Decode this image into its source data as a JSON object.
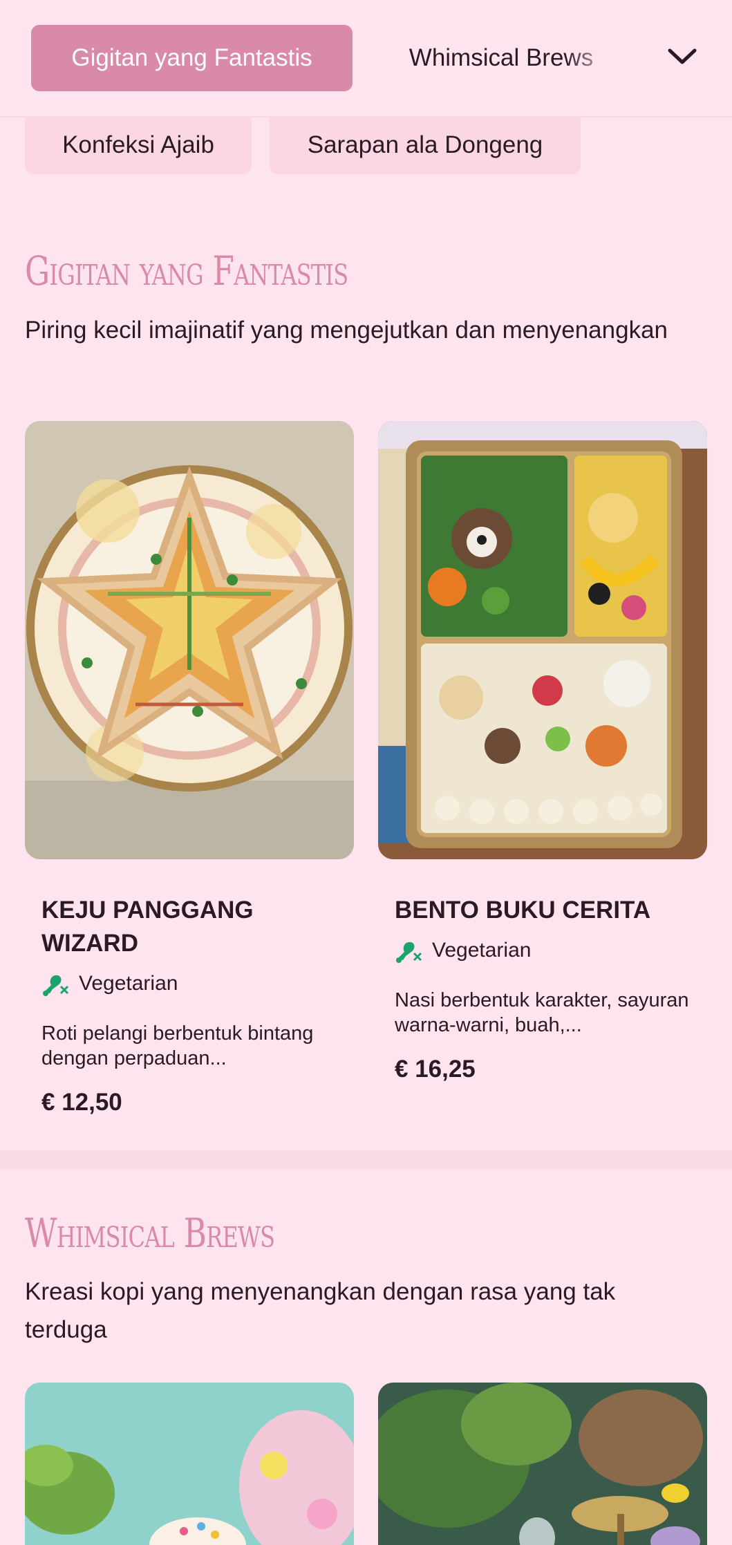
{
  "nav": {
    "active_label": "Gigitan yang Fantastis",
    "second_label": "Whimsical Brews",
    "pills": [
      "Konfeksi Ajaib",
      "Sarapan ala Dongeng"
    ],
    "accent": "#d98aa8"
  },
  "sections": [
    {
      "title": "Gigitan yang Fantastis",
      "description": "Piring kecil imajinatif yang mengejutkan dan menyenangkan",
      "items": [
        {
          "title": "Keju Panggang Wizard",
          "diet": "Vegetarian",
          "description": "Roti pelangi berbentuk bintang dengan perpaduan...",
          "price": "€ 12,50",
          "image_icon": "star-sandwich-image"
        },
        {
          "title": "Bento Buku Cerita",
          "diet": "Vegetarian",
          "description": "Nasi berbentuk karakter, sayuran warna-warni, buah,...",
          "price": "€ 16,25",
          "image_icon": "bento-box-image"
        }
      ]
    },
    {
      "title": "Whimsical Brews",
      "description": "Kreasi kopi yang menyenangkan dengan rasa yang tak terduga",
      "items": [
        {
          "image_icon": "whimsical-drink-image"
        },
        {
          "image_icon": "fairy-garden-image"
        }
      ]
    }
  ],
  "colors": {
    "background": "#fde4ee",
    "vegetarian_green": "#1aa36b"
  }
}
